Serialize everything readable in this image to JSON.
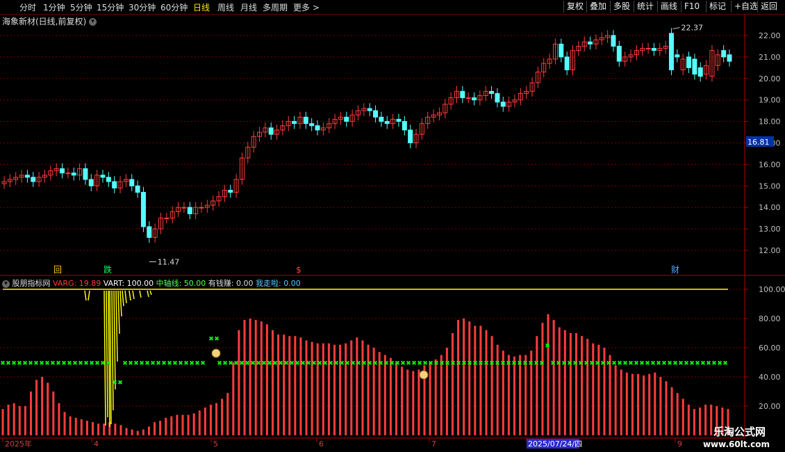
{
  "toolbar": {
    "periods": [
      "分时",
      "1分钟",
      "5分钟",
      "15分钟",
      "30分钟",
      "60分钟",
      "日线",
      "周线",
      "月线",
      "多周期",
      "更多"
    ],
    "active_period": "日线",
    "right_buttons": [
      "复权",
      "叠加",
      "多股",
      "统计",
      "画线",
      "F10",
      "标记",
      "+自选",
      "返回"
    ]
  },
  "header": {
    "stock_title": "海象新材(日线,前复权)",
    "icons": [
      "chevron-down-icon",
      "diamond-icon",
      "cube-icon"
    ]
  },
  "indicator": {
    "name": "股朋指标网",
    "items": [
      {
        "label": "VARG: 19.89",
        "color": "#ff3c3c"
      },
      {
        "label": "VART: 100.00",
        "color": "#ffffff"
      },
      {
        "label": "中轴线: 50.00",
        "color": "#55ff55"
      },
      {
        "label": "有钱赚: 0.00",
        "color": "#dddddd"
      },
      {
        "label": "我走啦: 0.00",
        "color": "#55ccff"
      }
    ]
  },
  "markers": {
    "high_label": "22.37",
    "low_label": "11.47",
    "current_price": "16.81",
    "events": [
      "回",
      "跌",
      "$",
      "财"
    ]
  },
  "date_axis": {
    "labels": [
      "2025年",
      "4",
      "5",
      "6",
      "7",
      "2025/07/24/四",
      "9"
    ]
  },
  "watermark": {
    "line1": "乐淘公式网",
    "line2": "www.60lt.com"
  },
  "colors": {
    "up": "#ff3c3c",
    "down": "#54ffff",
    "grid": "#7a0000",
    "axis": "#b00000",
    "yellow": "#ffff00",
    "green": "#00ff00"
  },
  "chart_data": [
    {
      "type": "candlestick",
      "title": "海象新材(日线,前复权)",
      "ylim": [
        11.0,
        22.6
      ],
      "yticks": [
        12.0,
        13.0,
        14.0,
        15.0,
        16.0,
        17.0,
        18.0,
        19.0,
        20.0,
        21.0,
        22.0
      ],
      "close": [
        15.2,
        15.3,
        15.4,
        15.5,
        15.4,
        15.2,
        15.4,
        15.5,
        15.7,
        15.8,
        15.6,
        15.6,
        15.5,
        15.8,
        15.3,
        15.0,
        15.5,
        15.4,
        15.2,
        14.9,
        15.2,
        15.3,
        15.0,
        14.7,
        13.1,
        12.6,
        13.0,
        13.5,
        13.5,
        13.8,
        14.0,
        14.0,
        13.7,
        14.0,
        14.0,
        14.1,
        14.3,
        14.5,
        14.8,
        14.7,
        15.3,
        16.3,
        16.8,
        17.3,
        17.5,
        17.7,
        17.4,
        17.6,
        17.8,
        18.0,
        17.9,
        18.2,
        17.9,
        17.8,
        17.6,
        17.7,
        17.9,
        18.1,
        18.2,
        18.0,
        18.3,
        18.5,
        18.6,
        18.5,
        18.2,
        18.0,
        17.9,
        18.1,
        18.0,
        17.6,
        17.0,
        17.4,
        17.9,
        18.2,
        18.3,
        18.4,
        18.8,
        19.1,
        19.4,
        19.1,
        19.1,
        19.0,
        19.2,
        19.4,
        19.3,
        18.9,
        18.7,
        18.9,
        19.0,
        19.3,
        19.4,
        19.8,
        20.3,
        20.7,
        20.9,
        21.6,
        21.0,
        20.4,
        21.3,
        21.5,
        21.7,
        21.6,
        21.8,
        21.9,
        22.0,
        21.5,
        20.8,
        21.0,
        21.1,
        21.3,
        21.4,
        21.4,
        21.3,
        21.4,
        21.5,
        20.4,
        21.0,
        20.9,
        20.5,
        20.2,
        20.1,
        20.6,
        21.3,
        21.1,
        21.0,
        20.8
      ],
      "open": [
        15.1,
        15.2,
        15.3,
        15.4,
        15.5,
        15.4,
        15.2,
        15.4,
        15.5,
        15.7,
        15.8,
        15.6,
        15.6,
        15.5,
        15.8,
        15.3,
        15.0,
        15.5,
        15.4,
        15.2,
        14.9,
        15.2,
        15.3,
        15.0,
        14.7,
        13.1,
        12.6,
        13.0,
        13.5,
        13.5,
        13.8,
        14.0,
        14.0,
        13.7,
        14.0,
        14.0,
        14.1,
        14.3,
        14.5,
        14.8,
        14.7,
        15.3,
        16.3,
        16.8,
        17.3,
        17.5,
        17.7,
        17.4,
        17.6,
        17.8,
        18.0,
        17.9,
        18.2,
        17.9,
        17.8,
        17.6,
        17.7,
        17.9,
        18.1,
        18.2,
        18.0,
        18.3,
        18.5,
        18.6,
        18.5,
        18.2,
        18.0,
        17.9,
        18.1,
        18.0,
        17.6,
        17.0,
        17.4,
        17.9,
        18.2,
        18.3,
        18.4,
        18.8,
        19.1,
        19.4,
        19.1,
        19.1,
        19.0,
        19.2,
        19.4,
        19.3,
        18.9,
        18.7,
        18.9,
        19.0,
        19.3,
        19.4,
        19.8,
        20.3,
        20.7,
        20.9,
        21.6,
        21.0,
        20.4,
        21.3,
        21.5,
        21.7,
        21.6,
        21.8,
        21.9,
        22.0,
        21.5,
        20.8,
        21.0,
        21.1,
        21.3,
        21.4,
        21.4,
        21.3,
        21.4,
        22.1,
        21.1,
        20.4,
        21.0,
        20.9,
        20.5,
        20.2,
        20.1,
        20.6,
        21.3,
        21.1
      ]
    },
    {
      "type": "bar",
      "title": "股朋指标网",
      "ylim": [
        0,
        105
      ],
      "yticks": [
        20.0,
        40.0,
        60.0,
        80.0,
        100.0
      ],
      "series": [
        {
          "name": "VARG",
          "values": [
            18,
            21,
            22,
            20,
            20,
            30,
            38,
            40,
            36,
            30,
            22,
            16,
            13,
            12,
            11,
            10,
            9,
            8,
            8,
            9,
            8,
            7,
            5,
            4,
            3,
            4,
            6,
            9,
            10,
            12,
            13,
            14,
            14,
            14,
            15,
            17,
            19,
            21,
            22,
            25,
            29,
            50,
            72,
            79,
            80,
            79,
            78,
            76,
            72,
            69,
            69,
            68,
            68,
            67,
            65,
            64,
            63,
            63,
            63,
            62,
            62,
            63,
            65,
            67,
            65,
            62,
            60,
            57,
            55,
            53,
            50,
            47,
            45,
            44,
            45,
            48,
            50,
            52,
            55,
            60,
            70,
            79,
            80,
            78,
            75,
            75,
            72,
            68,
            62,
            58,
            55,
            54,
            55,
            55,
            58,
            68,
            77,
            83,
            79,
            74,
            72,
            70,
            70,
            68,
            66,
            63,
            62,
            60,
            55,
            48,
            45,
            43,
            42,
            42,
            41,
            42,
            43,
            40,
            37,
            33,
            29,
            25,
            21,
            18,
            19,
            21,
            21,
            20,
            19,
            18
          ]
        },
        {
          "name": "VART",
          "values": [
            100,
            100,
            100,
            100,
            100,
            100,
            100,
            100,
            100,
            100,
            100,
            100,
            100,
            100,
            100,
            100,
            100,
            100,
            100,
            100,
            100,
            100,
            100,
            100,
            100,
            100,
            100,
            100,
            100,
            100,
            100,
            100,
            100,
            100,
            100,
            100,
            100,
            100,
            100,
            100,
            100,
            100,
            100,
            100,
            100,
            100,
            100,
            100,
            100,
            100,
            100,
            100,
            100,
            100,
            100,
            100,
            100,
            100,
            100,
            100,
            100,
            100,
            100,
            100,
            100,
            100,
            100,
            100,
            100,
            100,
            100,
            100,
            100,
            100,
            100,
            100,
            100,
            100,
            100,
            100,
            100,
            100,
            100,
            100,
            100,
            100,
            100,
            100,
            100,
            100,
            100,
            100,
            100,
            100,
            100,
            100,
            100,
            100,
            100,
            100,
            100,
            100,
            100,
            100,
            100,
            100,
            100,
            100,
            100,
            100,
            100,
            100,
            100,
            100,
            100,
            100,
            100,
            100,
            100,
            100,
            100,
            100,
            100,
            100,
            100,
            100,
            100,
            100,
            100,
            100
          ]
        },
        {
          "name": "中轴线",
          "values": [
            50,
            50,
            50,
            50,
            50,
            50,
            50,
            50,
            50,
            50,
            50,
            50,
            50,
            50,
            50,
            50,
            50,
            50,
            50,
            50,
            50,
            50,
            50,
            50,
            50,
            50,
            50,
            50,
            50,
            50,
            50,
            50,
            50,
            50,
            50,
            50,
            50,
            50,
            50,
            50,
            50,
            50,
            50,
            50,
            50,
            50,
            50,
            50,
            50,
            50,
            50,
            50,
            50,
            50,
            50,
            50,
            50,
            50,
            50,
            50,
            50,
            50,
            50,
            50,
            50,
            50,
            50,
            50,
            50,
            50,
            50,
            50,
            50,
            50,
            50,
            50,
            50,
            50,
            50,
            50,
            50,
            50,
            50,
            50,
            50,
            50,
            50,
            50,
            50,
            50,
            50,
            50,
            50,
            50,
            50,
            50,
            50,
            50,
            50,
            50,
            50,
            50,
            50,
            50,
            50,
            50,
            50,
            50,
            50,
            50,
            50,
            50,
            50,
            50,
            50,
            50,
            50,
            50,
            50,
            50,
            50,
            50,
            50,
            50,
            50,
            50,
            50,
            50,
            50,
            50
          ]
        }
      ]
    }
  ]
}
